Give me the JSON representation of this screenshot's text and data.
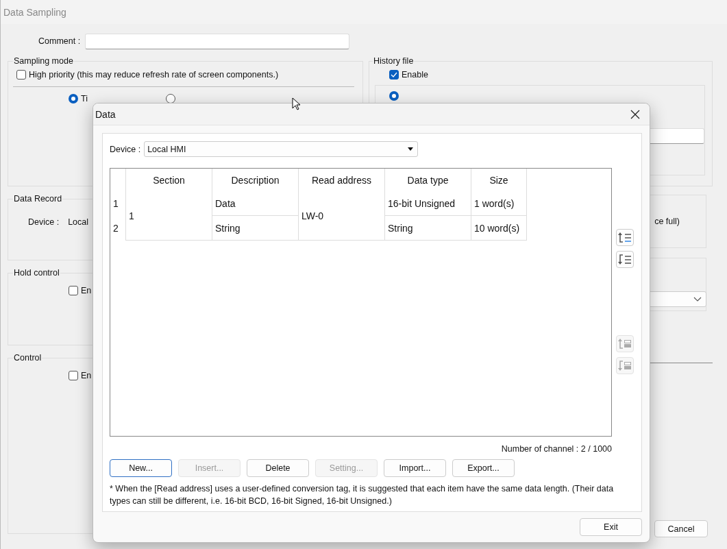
{
  "window": {
    "title": "Data Sampling"
  },
  "comment": {
    "label": "Comment :"
  },
  "sampling_mode": {
    "title": "Sampling mode",
    "high_priority": {
      "label": "High priority (this may reduce refresh rate of screen components.)",
      "checked": false
    },
    "modes": [
      {
        "label": "Ti",
        "selected": true
      },
      {
        "selected": false
      }
    ]
  },
  "data_record": {
    "title": "Data Record",
    "device_label": "Device :",
    "device_value": "Local"
  },
  "hold_control": {
    "title": "Hold control",
    "enable": {
      "label": "En",
      "checked": false
    }
  },
  "control": {
    "title": "Control",
    "enable": {
      "label": "En",
      "checked": false
    }
  },
  "history_file": {
    "title": "History file",
    "enable": {
      "label": "Enable",
      "checked": true
    },
    "location": {
      "selected": true
    },
    "full_text": "ce full)"
  },
  "cancel": "Cancel",
  "dialog": {
    "title": "Data",
    "device": {
      "label": "Device :",
      "value": "Local HMI"
    },
    "table": {
      "columns": [
        "Section",
        "Description",
        "Read address",
        "Data type",
        "Size"
      ],
      "sections": [
        {
          "section": "1",
          "read_address": "LW-0",
          "rows": [
            {
              "index": "1",
              "description": "Data",
              "data_type": "16-bit Unsigned",
              "size": "1 word(s)"
            },
            {
              "index": "2",
              "description": "String",
              "data_type": "String",
              "size": "10 word(s)"
            }
          ]
        }
      ]
    },
    "side_buttons": [
      {
        "kind": "row-up",
        "disabled": false
      },
      {
        "kind": "row-down",
        "disabled": false
      },
      {
        "kind": "section-up",
        "disabled": true
      },
      {
        "kind": "section-down",
        "disabled": true
      }
    ],
    "channel_count": "Number of channel :  2 / 1000",
    "buttons": [
      {
        "label": "New...",
        "disabled": false,
        "focused": true
      },
      {
        "label": "Insert...",
        "disabled": true,
        "focused": false
      },
      {
        "label": "Delete",
        "disabled": false,
        "focused": false
      },
      {
        "label": "Setting...",
        "disabled": true,
        "focused": false
      },
      {
        "label": "Import...",
        "disabled": false,
        "focused": false
      },
      {
        "label": "Export...",
        "disabled": false,
        "focused": false
      }
    ],
    "note": "* When the [Read address] uses a user-defined conversion tag, it is suggested that each item have the same data length. (Their data types can still be different, i.e. 16-bit BCD, 16-bit Signed, 16-bit Unsigned.)",
    "exit": "Exit"
  }
}
